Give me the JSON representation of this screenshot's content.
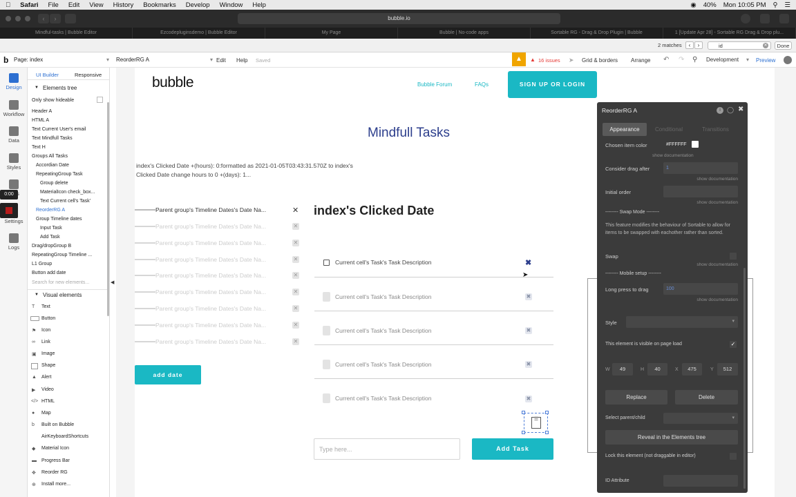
{
  "menubar": {
    "apple": "",
    "items": [
      "Safari",
      "File",
      "Edit",
      "View",
      "History",
      "Bookmarks",
      "Develop",
      "Window",
      "Help"
    ],
    "battery": "40%",
    "clock": "Mon 10:05 PM"
  },
  "browser": {
    "url": "bubble.io",
    "tabs": [
      "Mindful-tasks | Bubble Editor",
      "Ezcodepluginsdemo | Bubble Editor",
      "My Page",
      "Bubble | No-code apps",
      "Sortable RG - Drag & Drop Plugin | Bubble",
      "1 [Update Apr 28] - Sortable RG Drag & Drop plu..."
    ],
    "find_matches": "2 matches",
    "find_query": "id",
    "done_label": "Done"
  },
  "editor": {
    "page_label": "Page: index",
    "element_selector": "ReorderRG A",
    "edit": "Edit",
    "help": "Help",
    "saved": "Saved",
    "issues": "16 issues",
    "grid": "Grid & borders",
    "arrange": "Arrange",
    "development": "Development",
    "preview": "Preview"
  },
  "rail": {
    "design": "Design",
    "workflow": "Workflow",
    "data": "Data",
    "styles": "Styles",
    "timer": "0:00",
    "settings": "Settings",
    "logs": "Logs",
    "tions": "tions"
  },
  "left_panel": {
    "tab_ui": "UI Builder",
    "tab_responsive": "Responsive",
    "elements_tree": "Elements tree",
    "only_hideable": "Only show hideable",
    "tree": [
      "Header A",
      "HTML A",
      "Text Current User's email",
      "Text Mindfull Tasks",
      "Text H",
      "Groups All Tasks",
      "Accordian Date",
      "RepeatingGroup Task",
      "Group delete",
      "MaterialIcon check_box...",
      "Text Current cell's Task'",
      "ReorderRG A",
      "Group Timeline dates",
      "Input Task",
      "Add Task",
      "Drag/dropGroup B",
      "RepeatingGroup Timeline ...",
      "L1 Group",
      "Button add date"
    ],
    "search_placeholder": "Search for new elements...",
    "visual_elements": "Visual elements",
    "visual": [
      "Text",
      "Button",
      "Icon",
      "Link",
      "Image",
      "Shape",
      "Alert",
      "Video",
      "HTML",
      "Map",
      "Built on Bubble",
      "AirKeyboardShortcuts",
      "Material Icon",
      "Progress Bar",
      "Reorder RG",
      "Install more..."
    ]
  },
  "page": {
    "logo": "bubble",
    "forum": "Bubble Forum",
    "faqs": "FAQs",
    "signup": "SIGN UP OR LOGIN",
    "title": "Mindfull Tasks",
    "clicked_text": "index's Clicked Date +(hours): 0:formatted as 2021-01-05T03:43:31.570Z to index's Clicked Date change hours to 0 +(days): 1...",
    "timeline_label": "Parent group's Timeline Dates's Date Na...",
    "heading": "index's Clicked Date",
    "task_label": "Current cell's Task's Task Description",
    "add_date": "add date",
    "input_placeholder": "Type here...",
    "add_task": "Add Task"
  },
  "props": {
    "title": "ReorderRG A",
    "tab_appearance": "Appearance",
    "tab_conditional": "Conditional",
    "tab_transitions": "Transitions",
    "chosen_color_label": "Chosen item color",
    "chosen_color_value": "#FFFFFF",
    "show_doc": "show documentation",
    "drag_after_label": "Consider drag after",
    "drag_after_value": "1",
    "initial_order": "Initial order",
    "swap_mode": "-------- Swap Mode --------",
    "swap_desc": "This feature modifies the behaviour of Sortable to allow for items to be swapped with eachother rather than sorted.",
    "swap": "Swap",
    "mobile_setup": "-------- Mobile setup --------",
    "long_press_label": "Long press to drag",
    "long_press_value": "100",
    "style": "Style",
    "visible_on_load": "This element is visible on page load",
    "w_label": "W",
    "w": "49",
    "h_label": "H",
    "h": "40",
    "x_label": "X",
    "x": "475",
    "y_label": "Y",
    "y": "512",
    "replace": "Replace",
    "delete": "Delete",
    "select_parent": "Select parent/child",
    "reveal": "Reveal in the Elements tree",
    "lock": "Lock this element (not draggable in editor)",
    "id_attr": "ID Attribute"
  },
  "colors": {
    "accent": "#1ab8c4",
    "brand_blue": "#2c3e8c",
    "issues_orange": "#e8a000",
    "panel_dark": "#3b3b3b"
  }
}
